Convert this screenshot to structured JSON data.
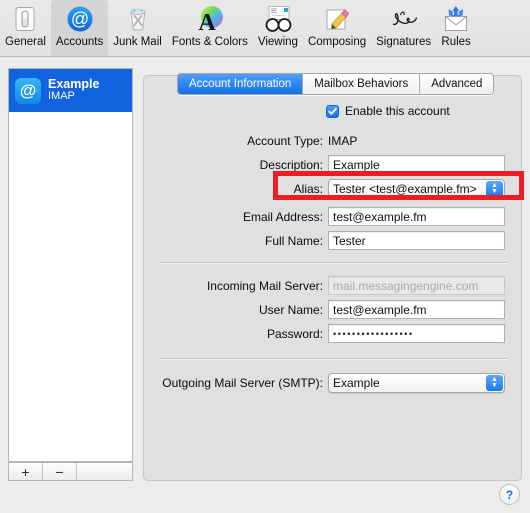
{
  "window": {
    "title": "Accounts"
  },
  "toolbar": {
    "items": [
      {
        "label": "General",
        "icon": "general-switch-icon",
        "selected": false
      },
      {
        "label": "Accounts",
        "icon": "at-sign-icon",
        "selected": true
      },
      {
        "label": "Junk Mail",
        "icon": "trash-x-icon",
        "selected": false
      },
      {
        "label": "Fonts & Colors",
        "icon": "font-color-wheel-icon",
        "selected": false
      },
      {
        "label": "Viewing",
        "icon": "glasses-icon",
        "selected": false
      },
      {
        "label": "Composing",
        "icon": "pencil-paper-icon",
        "selected": false
      },
      {
        "label": "Signatures",
        "icon": "signature-icon",
        "selected": false
      },
      {
        "label": "Rules",
        "icon": "envelope-arrows-icon",
        "selected": false
      }
    ]
  },
  "sidebar": {
    "accounts": [
      {
        "name": "Example",
        "type": "IMAP",
        "selected": true
      }
    ],
    "add_label": "+",
    "remove_label": "−"
  },
  "tabs": [
    {
      "label": "Account Information",
      "active": true
    },
    {
      "label": "Mailbox Behaviors",
      "active": false
    },
    {
      "label": "Advanced",
      "active": false
    }
  ],
  "form": {
    "enable_account": {
      "label": "Enable this account",
      "checked": true
    },
    "account_type": {
      "label": "Account Type:",
      "value": "IMAP"
    },
    "description": {
      "label": "Description:",
      "value": "Example"
    },
    "alias": {
      "label": "Alias:",
      "value": "Tester <test@example.fm>",
      "highlighted": true
    },
    "email_address": {
      "label": "Email Address:",
      "value": "test@example.fm"
    },
    "full_name": {
      "label": "Full Name:",
      "value": "Tester"
    },
    "incoming_mail_server": {
      "label": "Incoming Mail Server:",
      "placeholder": "mail.messagingengine.com",
      "value": ""
    },
    "user_name": {
      "label": "User Name:",
      "value": "test@example.fm"
    },
    "password": {
      "label": "Password:",
      "value": "•••••••••••••••••"
    },
    "outgoing_mail_server": {
      "label": "Outgoing Mail Server (SMTP):",
      "value": "Example"
    }
  },
  "help": {
    "label": "?"
  },
  "colors": {
    "accent_blue": "#1272e8",
    "selection_blue": "#1263e0",
    "annotation_red": "#ee1c25",
    "window_bg": "#ececec",
    "panel_bg": "#e0e0e0"
  }
}
